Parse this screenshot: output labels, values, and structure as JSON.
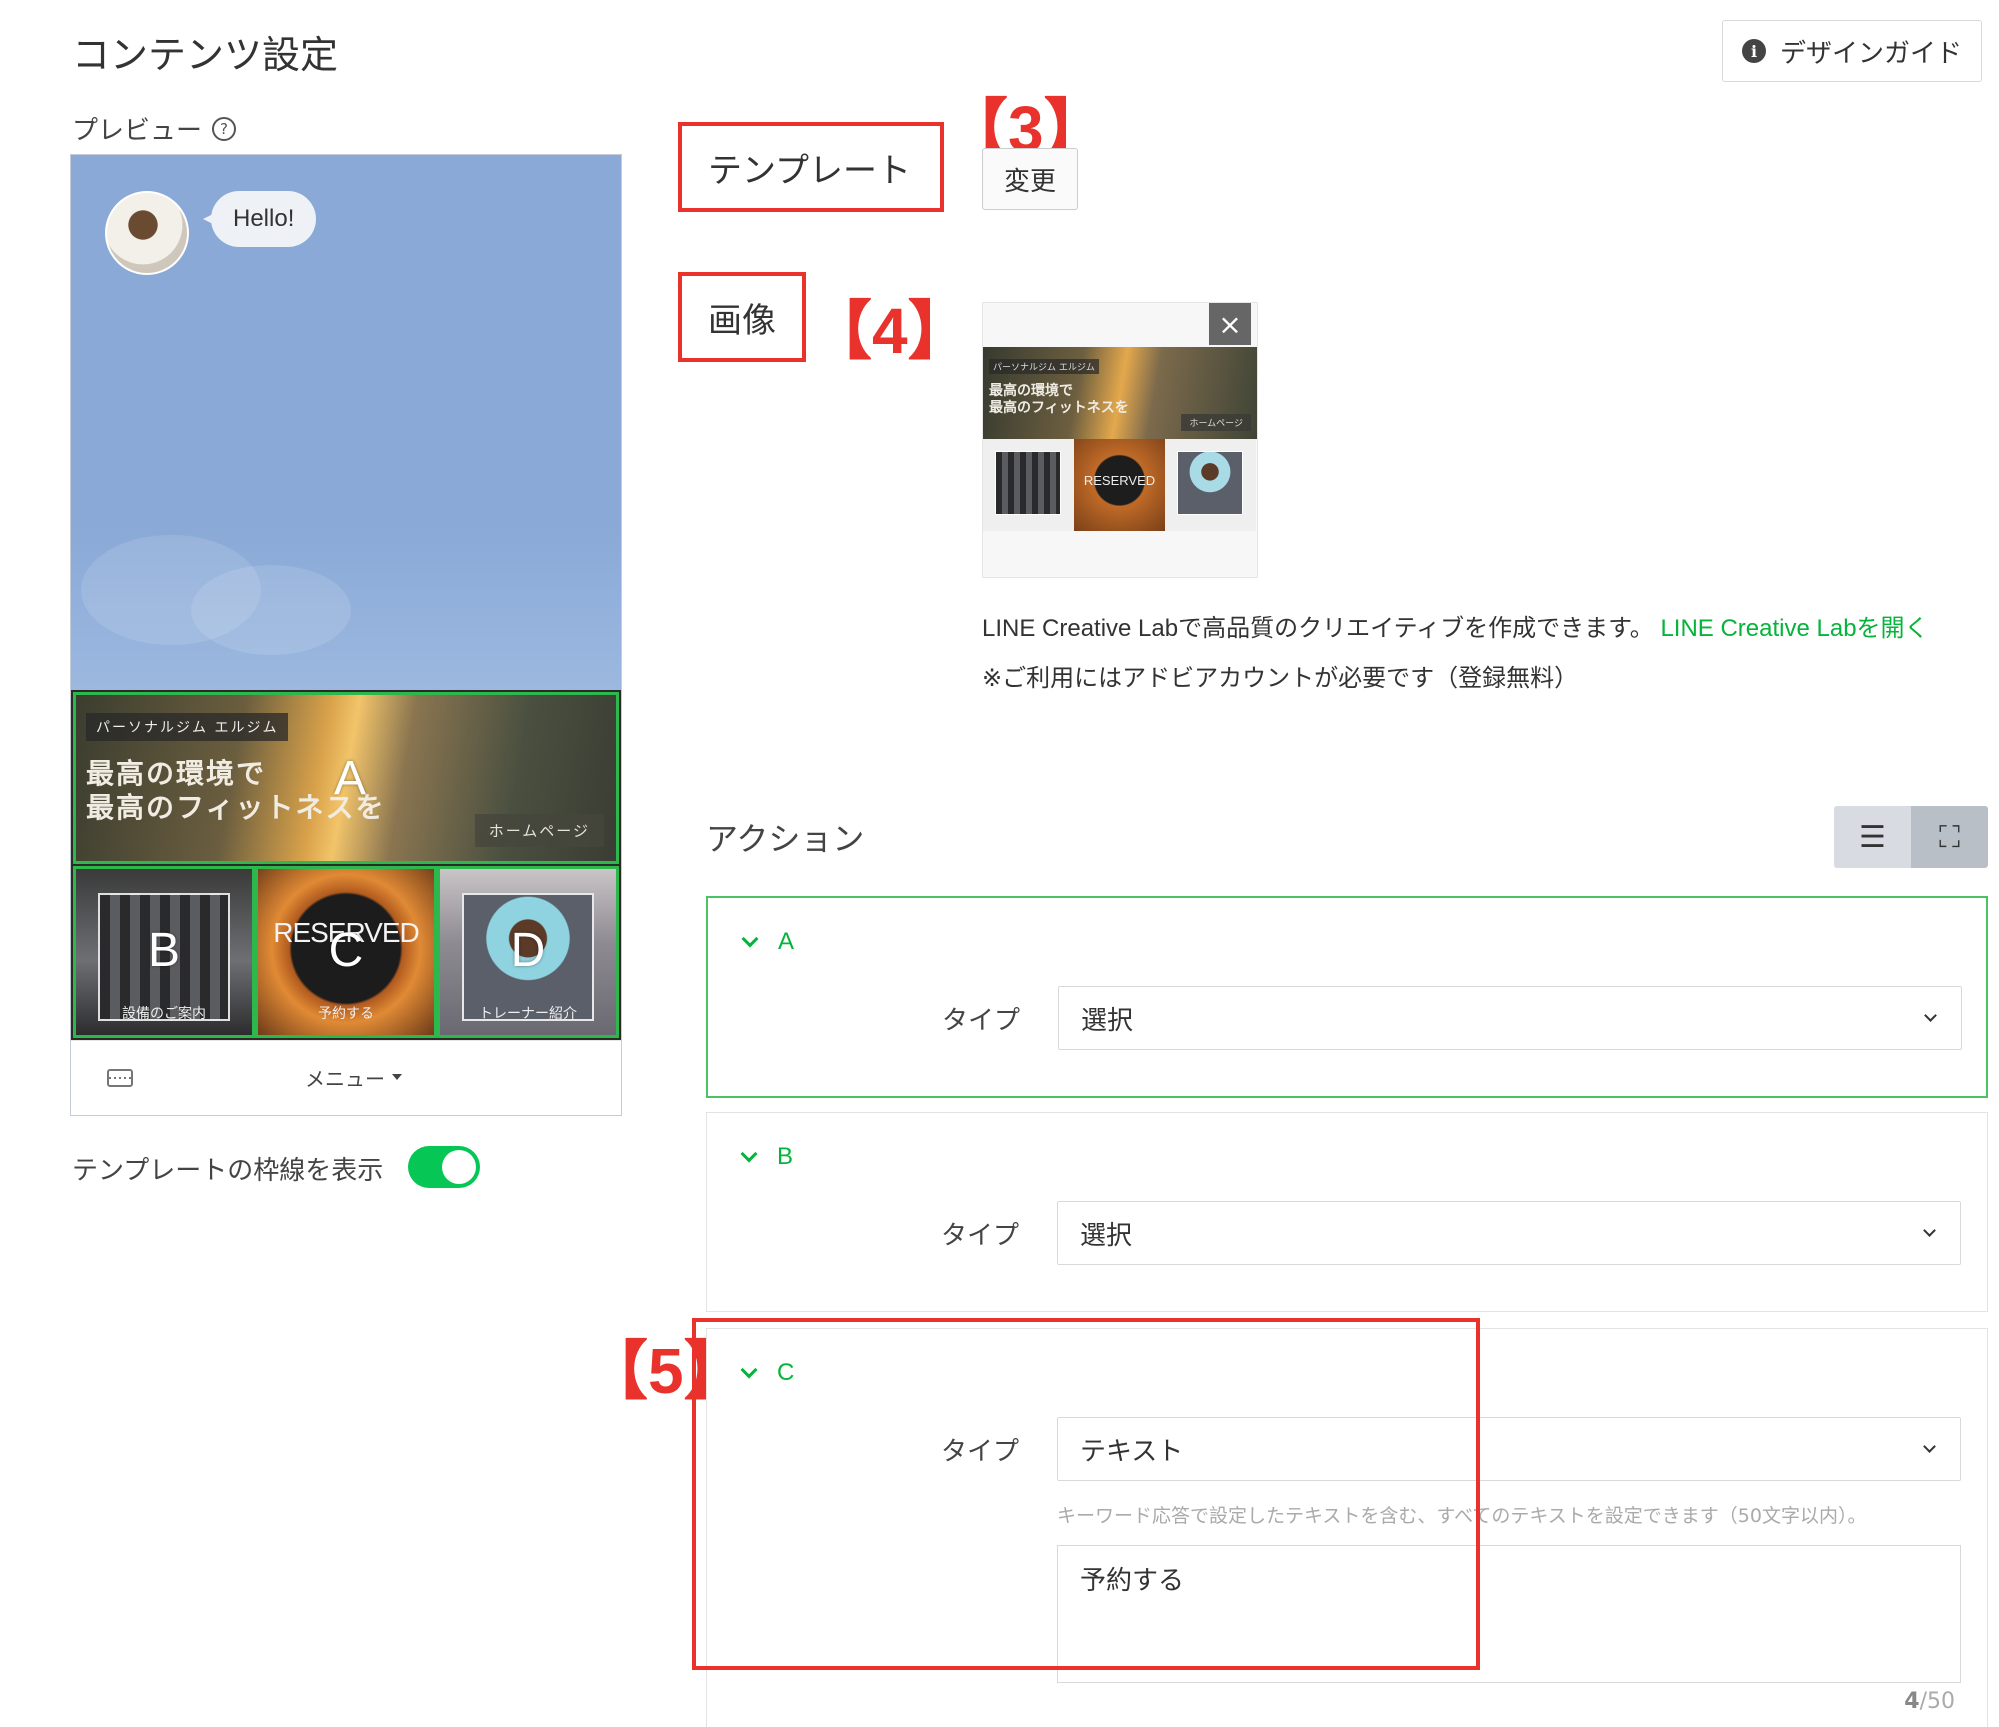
{
  "page": {
    "title": "コンテンツ設定",
    "design_guide_label": "デザインガイド"
  },
  "preview": {
    "label": "プレビュー",
    "greeting": "Hello!",
    "area_a": {
      "letter": "A",
      "tagline": "パーソナルジム エルジム",
      "headline_line1": "最高の環境で",
      "headline_line2": "最高のフィットネスを",
      "button_text": "ホームページ"
    },
    "area_b": {
      "letter": "B",
      "caption": "設備のご案内"
    },
    "area_c": {
      "letter": "C",
      "overlay": "RESERVED",
      "caption": "予約する"
    },
    "area_d": {
      "letter": "D",
      "caption": "トレーナー紹介"
    },
    "menu_label": "メニュー",
    "border_toggle_label": "テンプレートの枠線を表示",
    "border_toggle_on": true
  },
  "annotations": {
    "label_3": "【3】",
    "label_4": "【4】",
    "label_5": "【5】",
    "annotation_color": "#e8322b"
  },
  "template": {
    "label": "テンプレート",
    "change_button": "変更"
  },
  "image": {
    "label": "画像",
    "thumb_close": "×",
    "thumb_tagline": "パーソナルジム エルジム",
    "thumb_headline_line1": "最高の環境で",
    "thumb_headline_line2": "最高のフィットネスを",
    "thumb_button": "ホームページ",
    "thumb_reserved": "RESERVED",
    "creative_lab_text": "LINE Creative Labで高品質のクリエイティブを作成できます。",
    "creative_lab_link": "LINE Creative Labを開く",
    "note": "※ご利用にはアドビアカウントが必要です（登録無料）"
  },
  "actions": {
    "title": "アクション",
    "items": [
      {
        "name": "A",
        "type_label": "タイプ",
        "type_value": "選択"
      },
      {
        "name": "B",
        "type_label": "タイプ",
        "type_value": "選択"
      },
      {
        "name": "C",
        "type_label": "タイプ",
        "type_value": "テキスト",
        "hint": "キーワード応答で設定したテキストを含む、すべてのテキストを設定できます（50文字以内）。",
        "text": "予約する",
        "count": "4",
        "max": "/50"
      }
    ]
  },
  "colors": {
    "accent_green": "#06c755",
    "link_green": "#06b33b",
    "annotation_red": "#e8322b",
    "chat_background": "#8aa9d6"
  }
}
